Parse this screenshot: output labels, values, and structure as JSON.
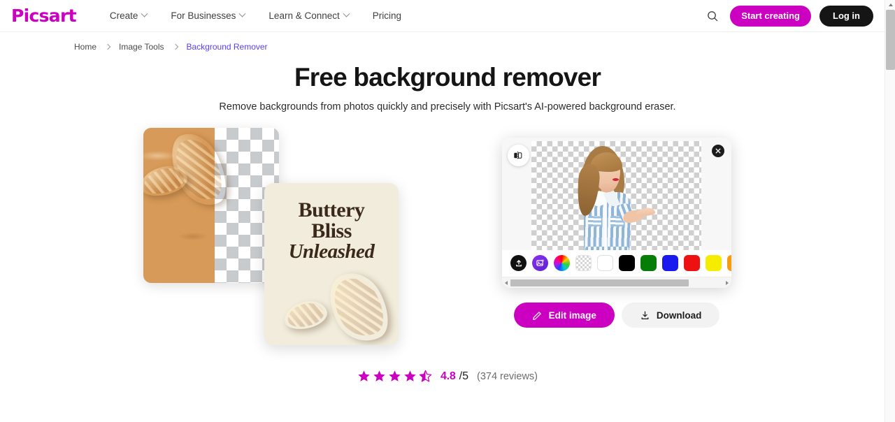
{
  "header": {
    "logo_text": "Picsart",
    "nav": [
      {
        "label": "Create",
        "has_dropdown": true
      },
      {
        "label": "For Businesses",
        "has_dropdown": true
      },
      {
        "label": "Learn & Connect",
        "has_dropdown": true
      },
      {
        "label": "Pricing",
        "has_dropdown": false
      }
    ],
    "search_icon": "search-icon",
    "start_creating_label": "Start creating",
    "login_label": "Log in",
    "brand_color": "#cc00c1",
    "login_bg": "#151515"
  },
  "breadcrumb": {
    "items": [
      {
        "label": "Home",
        "current": false
      },
      {
        "label": "Image Tools",
        "current": false
      },
      {
        "label": "Background Remover",
        "current": true
      }
    ],
    "current_color": "#5b3df5"
  },
  "hero": {
    "title": "Free background remover",
    "subtitle": "Remove backgrounds from photos quickly and precisely with Picsart's AI-powered background eraser."
  },
  "showcase": {
    "left": {
      "photo_card_alt": "croissants-on-wooden-board-before-after",
      "design_card": {
        "line1": "Buttery",
        "line2": "Bliss",
        "line3": "Unleashed",
        "bg_color": "#f1ecdc",
        "text_color": "#3b2a1c"
      }
    },
    "editor": {
      "compare_icon": "compare-split-icon",
      "close_icon": "close-icon",
      "canvas_alt": "woman-in-striped-shirt-cutout-on-transparent-background",
      "swatches": [
        {
          "name": "upload-image",
          "type": "upload",
          "color": "#111111"
        },
        {
          "name": "ai-background",
          "type": "ai",
          "color": "#6f2ae0"
        },
        {
          "name": "color-picker",
          "type": "wheel",
          "color": ""
        },
        {
          "name": "transparent",
          "type": "transparent",
          "color": ""
        },
        {
          "name": "white",
          "type": "color",
          "color": "#ffffff"
        },
        {
          "name": "black",
          "type": "color",
          "color": "#000000"
        },
        {
          "name": "green",
          "type": "color",
          "color": "#067d06"
        },
        {
          "name": "blue",
          "type": "color",
          "color": "#1a1aee"
        },
        {
          "name": "red",
          "type": "color",
          "color": "#ee1111"
        },
        {
          "name": "yellow",
          "type": "color",
          "color": "#f5ec00"
        },
        {
          "name": "orange",
          "type": "color",
          "color": "#f79c12"
        }
      ]
    },
    "actions": {
      "edit_label": "Edit image",
      "edit_icon": "pencil-icon",
      "download_label": "Download",
      "download_icon": "download-icon"
    }
  },
  "rating": {
    "stars_filled": 4,
    "stars_half": 1,
    "stars_total": 5,
    "score": "4.8",
    "out_of": "/5",
    "reviews": "(374 reviews)",
    "star_color": "#cc00c1"
  }
}
